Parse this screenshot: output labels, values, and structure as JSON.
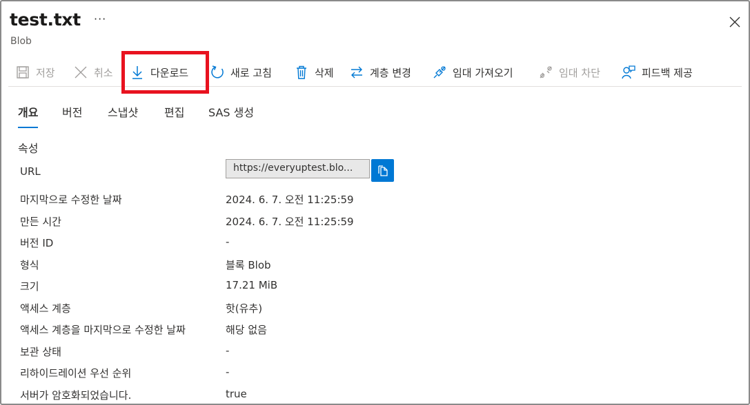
{
  "header": {
    "title": "test.txt",
    "more": "···",
    "subtitle": "Blob"
  },
  "toolbar": {
    "save": "저장",
    "cancel": "취소",
    "download": "다운로드",
    "refresh": "새로 고침",
    "delete": "삭제",
    "change_tier": "계층 변경",
    "acquire_lease": "임대 가져오기",
    "break_lease": "임대 차단",
    "feedback": "피드백 제공"
  },
  "tabs": [
    "개요",
    "버전",
    "스냅샷",
    "편집",
    "SAS 생성"
  ],
  "properties": {
    "section_title": "속성",
    "url_label": "URL",
    "url_value": "https://everyuptest.blo...",
    "rows": [
      {
        "label": "마지막으로 수정한 날짜",
        "value": "2024. 6. 7. 오전 11:25:59"
      },
      {
        "label": "만든 시간",
        "value": "2024. 6. 7. 오전 11:25:59"
      },
      {
        "label": "버전 ID",
        "value": "-"
      },
      {
        "label": "형식",
        "value": "블록 Blob"
      },
      {
        "label": "크기",
        "value": "17.21 MiB"
      },
      {
        "label": "액세스 계층",
        "value": "핫(유추)"
      },
      {
        "label": "액세스 계층을 마지막으로 수정한 날짜",
        "value": "해당 없음"
      },
      {
        "label": "보관 상태",
        "value": "-"
      },
      {
        "label": "리하이드레이션 우선 순위",
        "value": "-"
      },
      {
        "label": "서버가 암호화되었습니다.",
        "value": "true"
      }
    ]
  },
  "colors": {
    "accent": "#0078d4",
    "highlight": "#e8121f"
  }
}
